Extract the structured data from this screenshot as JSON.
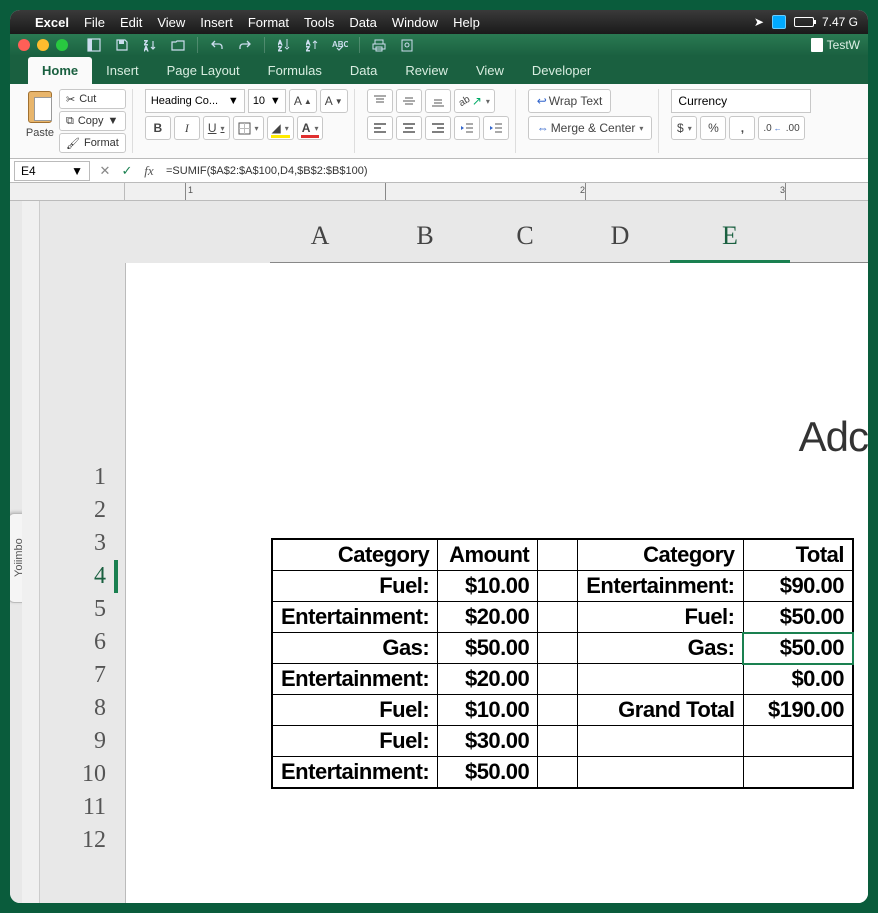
{
  "mac": {
    "app": "Excel",
    "menus": [
      "File",
      "Edit",
      "View",
      "Insert",
      "Format",
      "Tools",
      "Data",
      "Window",
      "Help"
    ],
    "battery_text": "7.47 G"
  },
  "doc_name": "TestW",
  "tabs": [
    "Home",
    "Insert",
    "Page Layout",
    "Formulas",
    "Data",
    "Review",
    "View",
    "Developer"
  ],
  "active_tab": "Home",
  "ribbon": {
    "paste": "Paste",
    "cut": "Cut",
    "copy": "Copy",
    "format": "Format",
    "font_name": "Heading Co...",
    "font_size": "10",
    "wrap": "Wrap Text",
    "merge": "Merge & Center",
    "numfmt": "Currency"
  },
  "fbar": {
    "cell": "E4",
    "formula": "=SUMIF($A$2:$A$100,D4,$B$2:$B$100)"
  },
  "big_cols": [
    "A",
    "B",
    "C",
    "D",
    "E"
  ],
  "rows": [
    "1",
    "2",
    "3",
    "4",
    "5",
    "6",
    "7",
    "8",
    "9",
    "10",
    "11",
    "12"
  ],
  "active_row": "4",
  "side_tab": "Yojimbo",
  "page_title": "Adc",
  "chart_data": {
    "type": "table",
    "headers_left": [
      "Category",
      "Amount"
    ],
    "headers_right": [
      "Category",
      "Total"
    ],
    "left": [
      {
        "category": "Fuel:",
        "amount": "$10.00"
      },
      {
        "category": "Entertainment:",
        "amount": "$20.00"
      },
      {
        "category": "Gas:",
        "amount": "$50.00"
      },
      {
        "category": "Entertainment:",
        "amount": "$20.00"
      },
      {
        "category": "Fuel:",
        "amount": "$10.00"
      },
      {
        "category": "Fuel:",
        "amount": "$30.00"
      },
      {
        "category": "Entertainment:",
        "amount": "$50.00"
      }
    ],
    "right": [
      {
        "category": "Entertainment:",
        "total": "$90.00"
      },
      {
        "category": "Fuel:",
        "total": "$50.00"
      },
      {
        "category": "Gas:",
        "total": "$50.00"
      },
      {
        "category": "",
        "total": "$0.00"
      },
      {
        "category": "Grand Total",
        "total": "$190.00"
      }
    ],
    "selected_right_row": 2
  }
}
